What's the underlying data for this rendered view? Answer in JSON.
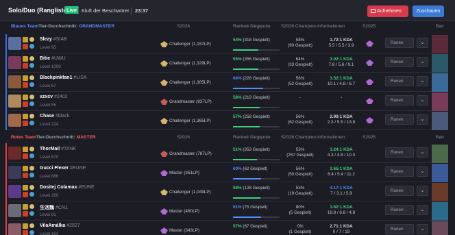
{
  "header": {
    "title": "Solo/Duo (Rangliste)",
    "live": "Live",
    "map": "Kluft der Beschwörer",
    "time": "23:37",
    "watch": "Aufnehmen",
    "add": "Zuschauen"
  },
  "cols": {
    "s26": "S2026",
    "ranked": "Ranked-Siegquote",
    "champ": "S2026 Champion-Informationen",
    "s25": "S2025",
    "ban": "Ban"
  },
  "blue": {
    "name": "Blaues Team",
    "avg_label": "Tier-Durchschnitt:",
    "avg": "GRANDMASTER"
  },
  "red": {
    "name": "Rotes Team",
    "avg_label": "Tier-Durchschnitt:",
    "avg": "MASTER"
  },
  "rows": [
    {
      "name": "Slezy",
      "tag": "#SIAB",
      "level": "Level 95",
      "rank": "Challenger (1,157LP)",
      "wr": "54%",
      "wrg": "(318 Gespielt)",
      "wrpct": 54,
      "cwr": "58%",
      "cg": "(90 Gespielt)",
      "kda": "1.72:1 KDA",
      "kdas": "5.5 / 5.5 / 3.9",
      "runen": "Runen",
      "kdacol": "w",
      "wrcol": "g"
    },
    {
      "name": "Bitie",
      "tag": "#UWU",
      "level": "Level 1009",
      "rank": "Challenger (1,329LP)",
      "wr": "55%",
      "wrg": "(356 Gespielt)",
      "wrpct": 55,
      "cwr": "64%",
      "cg": "(33 Gespielt)",
      "kda": "3.02:1 KDA",
      "kdas": "7.8 / 5.6 / 9.1",
      "runen": "Runen",
      "kdacol": "g",
      "wrcol": "g"
    },
    {
      "name": "Blackpinkfan1",
      "tag": "#LISA",
      "level": "Level 67",
      "rank": "Challenger (1,305LP)",
      "wr": "64%",
      "wrg": "(228 Gespielt)",
      "wrpct": 64,
      "cwr": "56%",
      "cg": "(52 Gespielt)",
      "kda": "3.52:1 KDA",
      "kdas": "10.1 / 4.8 / 6.7",
      "runen": "Runen",
      "kdacol": "g",
      "wrcol": "b"
    },
    {
      "name": "xzxcv",
      "tag": "#2402",
      "level": "Level 56",
      "rank": "Grandmaster (937LP)",
      "wr": "58%",
      "wrg": "(219 Gespielt)",
      "wrpct": 58,
      "cwr": "-",
      "cg": "",
      "kda": "-",
      "kdas": "",
      "runen": "Runen",
      "kdacol": "w",
      "wrcol": "g"
    },
    {
      "name": "Chase",
      "tag": "#black",
      "level": "Level 224",
      "rank": "Challenger (1,365LP)",
      "wr": "57%",
      "wrg": "(258 Gespielt)",
      "wrpct": 57,
      "cwr": "56%",
      "cg": "(62 Gespielt)",
      "kda": "2.90:1 KDA",
      "kdas": "2.3 / 5.5 / 13.8",
      "runen": "Runen",
      "kdacol": "w",
      "wrcol": "g"
    },
    {
      "name": "ThorMail",
      "tag": "#TANK",
      "level": "Level 670",
      "rank": "Grandmaster (787LP)",
      "wr": "51%",
      "wrg": "(353 Gespielt)",
      "wrpct": 51,
      "cwr": "53%",
      "cg": "(257 Gespielt)",
      "kda": "3.24:1 KDA",
      "kdas": "4.3 / 4.5 / 10.3",
      "runen": "Runen",
      "kdacol": "g",
      "wrcol": "g"
    },
    {
      "name": "Gucci Flexer",
      "tag": "#EUNE",
      "level": "Level 886",
      "rank": "Master (351LP)",
      "wr": "60%",
      "wrg": "(62 Gespielt)",
      "wrpct": 60,
      "cwr": "56%",
      "cg": "(50 Gespielt)",
      "kda": "3.65:1 KDA",
      "kdas": "8.4 / 5.4 / 11.2",
      "runen": "Runen",
      "kdacol": "g",
      "wrcol": "b"
    },
    {
      "name": "Dositej Colamax",
      "tag": "#EUNE",
      "level": "Level 260",
      "rank": "Challenger (1,049LP)",
      "wr": "59%",
      "wrg": "(128 Gespielt)",
      "wrpct": 59,
      "cwr": "53%",
      "cg": "(19 Gespielt)",
      "kda": "4.17:1 KDA",
      "kdas": "7 / 3.1 / 5.9",
      "runen": "Runen",
      "kdacol": "b",
      "wrcol": "g"
    },
    {
      "name": "生活魏",
      "tag": "#CN1",
      "level": "Level 61",
      "rank": "Master (460LP)",
      "wr": "61%",
      "wrg": "(75 Gespielt)",
      "wrpct": 61,
      "cwr": "80%",
      "cg": "(5 Gespielt)",
      "kda": "3.62:1 KDA",
      "kdas": "19.8 / 6.8 / 4.8",
      "runen": "Runen",
      "kdacol": "g",
      "wrcol": "b"
    },
    {
      "name": "VilaAmálka",
      "tag": "#2527",
      "level": "Level 162",
      "rank": "Master (343LP)",
      "wr": "57%",
      "wrg": "(67 Gespielt)",
      "wrpct": 57,
      "cwr": "0%",
      "cg": "(1 Gespielt)",
      "kda": "2.71:1 KDA",
      "kdas": "0 / 7 / 19",
      "runen": "Runen",
      "kdacol": "w",
      "wrcol": "g"
    }
  ]
}
